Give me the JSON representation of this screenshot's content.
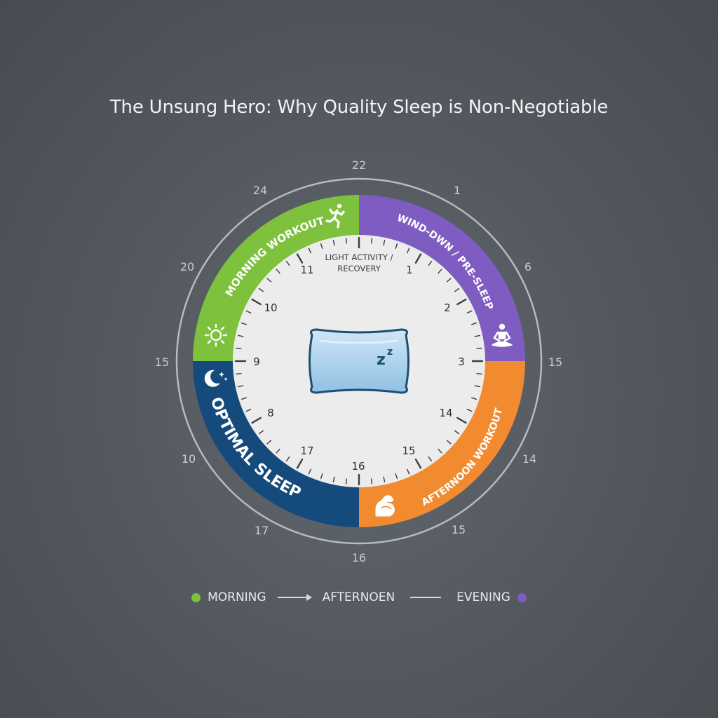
{
  "title": "The Unsung Hero: Why Quality Sleep is Non-Negotiable",
  "outer_ring_numbers": [
    "22",
    "1",
    "6",
    "15",
    "14",
    "15",
    "16",
    "17",
    "10",
    "15",
    "20",
    "24"
  ],
  "dial_numbers": [
    "1",
    "2",
    "3",
    "14",
    "15",
    "16",
    "17",
    "8",
    "9",
    "10",
    "11"
  ],
  "segments": {
    "morning_workout": {
      "label": "MORNING WORKOUT",
      "color": "#7dc13c",
      "icon": "running-person-icon"
    },
    "wind_down": {
      "label": "WIND-DWN / PRE-SLEEP",
      "color": "#7e5cc2",
      "icon": "meditation-icon"
    },
    "afternoon_workout": {
      "label": "AFTERNOON WORKOUT",
      "color": "#f28a30",
      "icon": "flexed-arm-icon"
    },
    "optimal_sleep": {
      "label": "OPTIMAL SLEEP",
      "color": "#144a7c",
      "icon": "moon-stars-icon"
    },
    "sun_icon": "sun-icon"
  },
  "center": {
    "label_line1": "LIGHT ACTIVITY /",
    "label_line2": "RECOVERY",
    "icon": "pillow-icon",
    "zzz": "z",
    "zzz_small": "z"
  },
  "legend": {
    "morning": {
      "label": "MORNING",
      "color": "#7dc13c"
    },
    "afternoon": {
      "label": "AFTERNOEN"
    },
    "evening": {
      "label": "EVENING",
      "color": "#7e5cc2"
    }
  }
}
